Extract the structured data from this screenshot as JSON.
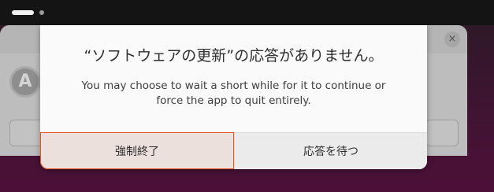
{
  "topbar": {
    "workspace_indicator_active": true
  },
  "background_window": {
    "app_icon_letter": "A",
    "close_glyph": "×"
  },
  "dialog": {
    "title": "“ソフトウェアの更新”の応答がありません。",
    "body": "You may choose to wait a short while for it to continue or force the app to quit entirely.",
    "force_quit_label": "強制終了",
    "wait_label": "応答を待つ"
  },
  "colors": {
    "accent": "#e95420",
    "dialog_bg": "#fafafa",
    "topbar_bg": "#141414"
  }
}
